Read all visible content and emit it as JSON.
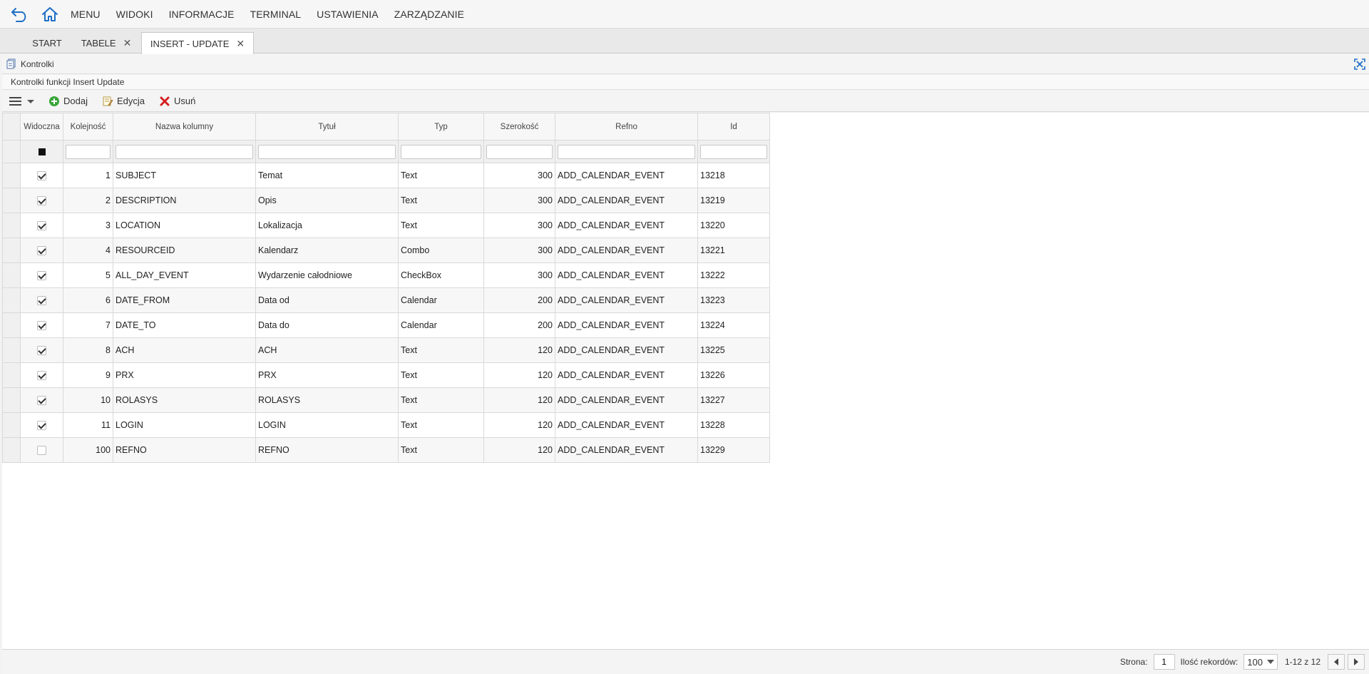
{
  "menubar": {
    "items": [
      "MENU",
      "WIDOKI",
      "INFORMACJE",
      "TERMINAL",
      "USTAWIENIA",
      "ZARZĄDZANIE"
    ]
  },
  "tabs": [
    {
      "label": "START",
      "closable": false,
      "active": false
    },
    {
      "label": "TABELE",
      "closable": true,
      "active": false
    },
    {
      "label": "INSERT - UPDATE",
      "closable": true,
      "active": true
    }
  ],
  "panel": {
    "title": "Kontrolki",
    "subtitle": "Kontrolki funkcji Insert Update"
  },
  "toolbar": {
    "add_label": "Dodaj",
    "edit_label": "Edycja",
    "delete_label": "Usuń"
  },
  "grid": {
    "columns": [
      "Widoczna",
      "Kolejność",
      "Nazwa kolumny",
      "Tytuł",
      "Typ",
      "Szerokość",
      "Refno",
      "Id"
    ],
    "rows": [
      {
        "visible": true,
        "order": "1",
        "name": "SUBJECT",
        "title": "Temat",
        "type": "Text",
        "width": "300",
        "refno": "ADD_CALENDAR_EVENT",
        "id": "13218"
      },
      {
        "visible": true,
        "order": "2",
        "name": "DESCRIPTION",
        "title": "Opis",
        "type": "Text",
        "width": "300",
        "refno": "ADD_CALENDAR_EVENT",
        "id": "13219"
      },
      {
        "visible": true,
        "order": "3",
        "name": "LOCATION",
        "title": "Lokalizacja",
        "type": "Text",
        "width": "300",
        "refno": "ADD_CALENDAR_EVENT",
        "id": "13220"
      },
      {
        "visible": true,
        "order": "4",
        "name": "RESOURCEID",
        "title": "Kalendarz",
        "type": "Combo",
        "width": "300",
        "refno": "ADD_CALENDAR_EVENT",
        "id": "13221"
      },
      {
        "visible": true,
        "order": "5",
        "name": "ALL_DAY_EVENT",
        "title": "Wydarzenie całodniowe",
        "type": "CheckBox",
        "width": "300",
        "refno": "ADD_CALENDAR_EVENT",
        "id": "13222"
      },
      {
        "visible": true,
        "order": "6",
        "name": "DATE_FROM",
        "title": "Data od",
        "type": "Calendar",
        "width": "200",
        "refno": "ADD_CALENDAR_EVENT",
        "id": "13223"
      },
      {
        "visible": true,
        "order": "7",
        "name": "DATE_TO",
        "title": "Data do",
        "type": "Calendar",
        "width": "200",
        "refno": "ADD_CALENDAR_EVENT",
        "id": "13224"
      },
      {
        "visible": true,
        "order": "8",
        "name": "ACH",
        "title": "ACH",
        "type": "Text",
        "width": "120",
        "refno": "ADD_CALENDAR_EVENT",
        "id": "13225"
      },
      {
        "visible": true,
        "order": "9",
        "name": "PRX",
        "title": "PRX",
        "type": "Text",
        "width": "120",
        "refno": "ADD_CALENDAR_EVENT",
        "id": "13226"
      },
      {
        "visible": true,
        "order": "10",
        "name": "ROLASYS",
        "title": "ROLASYS",
        "type": "Text",
        "width": "120",
        "refno": "ADD_CALENDAR_EVENT",
        "id": "13227"
      },
      {
        "visible": true,
        "order": "11",
        "name": "LOGIN",
        "title": "LOGIN",
        "type": "Text",
        "width": "120",
        "refno": "ADD_CALENDAR_EVENT",
        "id": "13228"
      },
      {
        "visible": false,
        "order": "100",
        "name": "REFNO",
        "title": "REFNO",
        "type": "Text",
        "width": "120",
        "refno": "ADD_CALENDAR_EVENT",
        "id": "13229"
      }
    ]
  },
  "footer": {
    "page_label": "Strona:",
    "page_value": "1",
    "records_label": "Ilość rekordów:",
    "records_value": "100",
    "range_text": "1-12 z 12"
  },
  "colors": {
    "accent": "#1e6fc7",
    "add_green": "#3aa53a",
    "delete_red": "#d61f1f"
  },
  "icons": {
    "back": "back-arrow-icon",
    "home": "home-icon",
    "panel": "page-icon",
    "maximize": "maximize-icon",
    "menu": "hamburger-icon",
    "add": "plus-circle-icon",
    "edit": "edit-icon",
    "delete": "x-icon"
  }
}
